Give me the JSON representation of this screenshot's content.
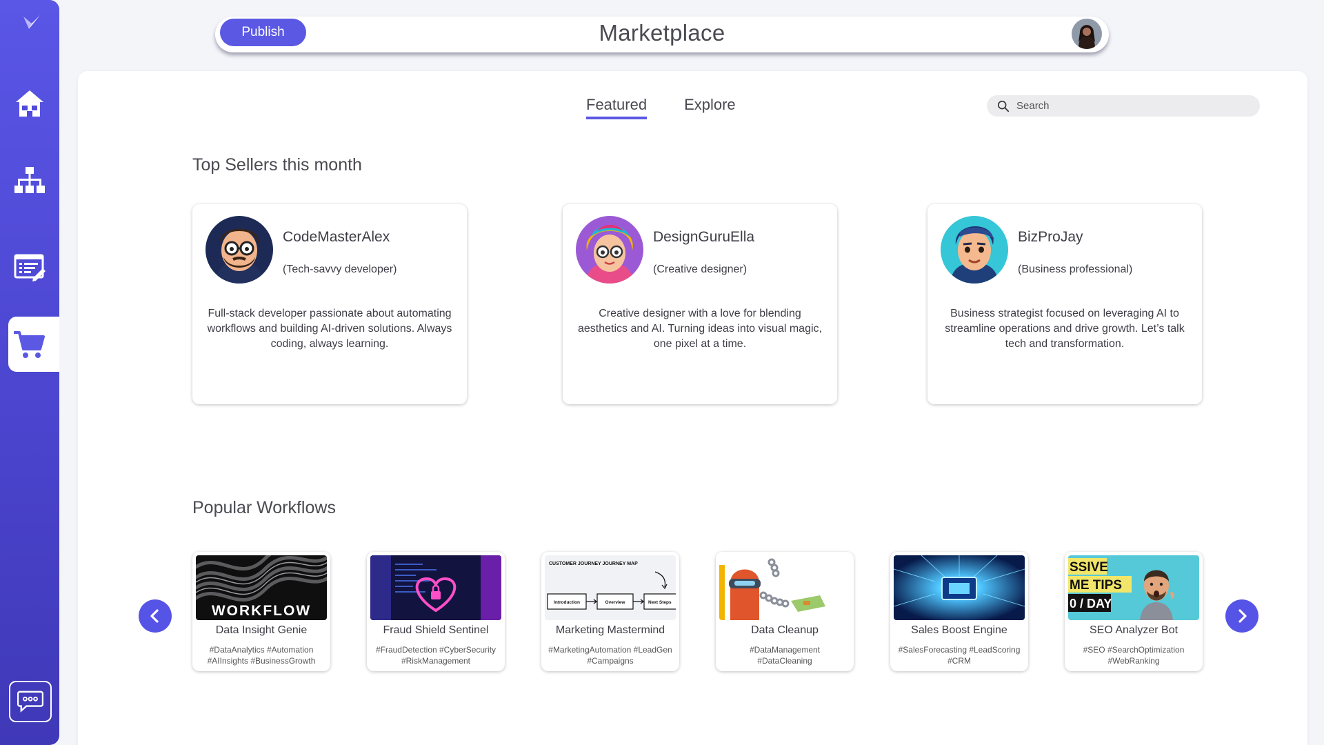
{
  "header": {
    "publish_label": "Publish",
    "title": "Marketplace"
  },
  "tabs": [
    {
      "label": "Featured",
      "active": true
    },
    {
      "label": "Explore",
      "active": false
    }
  ],
  "search": {
    "placeholder": "Search",
    "value": ""
  },
  "sellers_section": {
    "title": "Top Sellers this month"
  },
  "sellers": [
    {
      "name": "CodeMasterAlex",
      "role": "(Tech-savvy developer)",
      "description": "Full-stack developer passionate about automating workflows and building AI-driven solutions. Always coding, always learning."
    },
    {
      "name": "DesignGuruElla",
      "role": "(Creative designer)",
      "description": "Creative designer with a love for blending aesthetics and AI. Turning ideas into visual magic, one pixel at a time."
    },
    {
      "name": "BizProJay",
      "role": "(Business professional)",
      "description": "Business strategist focused on leveraging AI to streamline operations and drive growth. Let’s talk tech and transformation."
    }
  ],
  "workflows_section": {
    "title": "Popular Workflows"
  },
  "workflows": [
    {
      "title": "Data Insight Genie",
      "tags": "#DataAnalytics #Automation #AIInsights #BusinessGrowth",
      "thumb_text": "WORKFLOW"
    },
    {
      "title": "Fraud Shield Sentinel",
      "tags": "#FraudDetection #CyberSecurity #RiskManagement"
    },
    {
      "title": "Marketing Mastermind",
      "tags": "#MarketingAutomation #LeadGen #Campaigns",
      "thumb_text": "CUSTOMER JOURNEY JOURNEY MAP",
      "thumb_steps": [
        "Introduction",
        "Overview",
        "Next Steps"
      ]
    },
    {
      "title": "Data Cleanup",
      "tags": "#DataManagement #DataCleaning"
    },
    {
      "title": "Sales Boost Engine",
      "tags": "#SalesForecasting #LeadScoring #CRM"
    },
    {
      "title": "SEO Analyzer Bot",
      "tags": "#SEO #SearchOptimization #WebRanking",
      "thumb_lines": [
        "SSIVE",
        "ME TIPS",
        "0 / DAY"
      ]
    }
  ],
  "colors": {
    "accent": "#5b58e4",
    "sidebar_top": "#5a56e6",
    "sidebar_bottom": "#3f38b7"
  },
  "icons": {
    "logo": "brand-logo-icon",
    "nav": [
      "home-icon",
      "hierarchy-icon",
      "edit-document-icon",
      "shopping-cart-icon"
    ],
    "chat": "chat-bubble-icon"
  }
}
